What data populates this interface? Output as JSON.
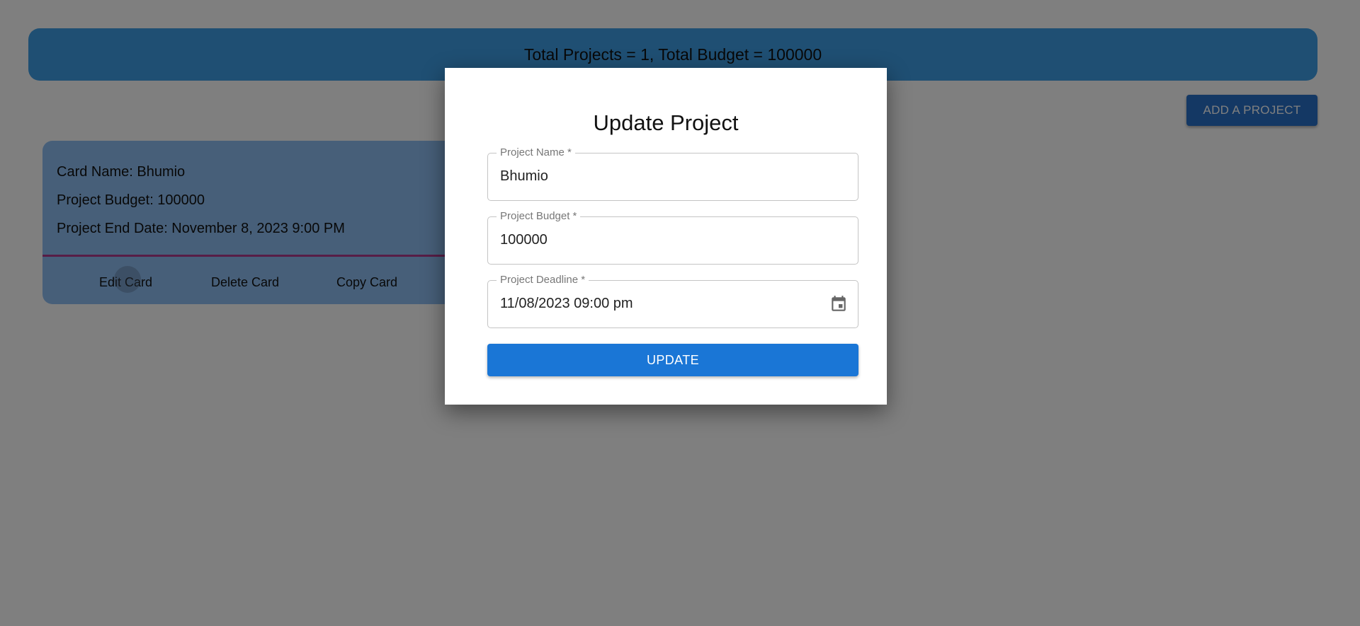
{
  "summary": {
    "text": "Total Projects = 1, Total Budget = 100000"
  },
  "toolbar": {
    "add_label": "ADD A PROJECT"
  },
  "card": {
    "name_line": "Card Name: Bhumio",
    "budget_line": "Project Budget: 100000",
    "end_date_line": "Project End Date: November 8, 2023 9:00 PM",
    "actions": {
      "edit": "Edit Card",
      "delete": "Delete Card",
      "copy": "Copy Card"
    }
  },
  "modal": {
    "title": "Update Project",
    "fields": {
      "name": {
        "label": "Project Name *",
        "value": "Bhumio"
      },
      "budget": {
        "label": "Project Budget *",
        "value": "100000"
      },
      "deadline": {
        "label": "Project Deadline *",
        "value": "11/08/2023 09:00 pm",
        "icon": "calendar-icon"
      }
    },
    "submit_label": "UPDATE"
  },
  "colors": {
    "summary_bg": "#3f9fe6",
    "card_bg": "#8fbff2",
    "card_divider": "#b03a8c",
    "primary_button": "#1a76d6",
    "backdrop": "rgba(0,0,0,0.5)"
  }
}
